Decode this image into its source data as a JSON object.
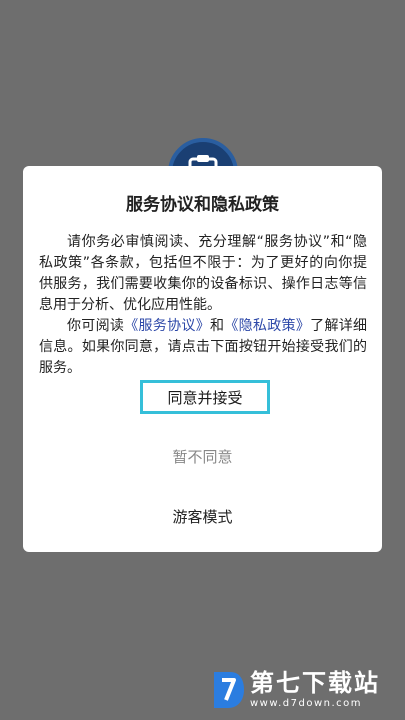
{
  "dialog": {
    "title": "服务协议和隐私政策",
    "para1": "请你务必审慎阅读、充分理解“服务协议”和“隐私政策”各条款，包括但不限于：为了更好的向你提供服务，我们需要收集你的设备标识、操作日志等信息用于分析、优化应用性能。",
    "para2_before": "你可阅读",
    "link_terms": "《服务协议》",
    "para2_and": "和",
    "link_privacy": "《隐私政策》",
    "para2_after": "了解详细信息。如果你同意，请点击下面按钮开始接受我们的服务。",
    "agree_label": "同意并接受",
    "disagree_label": "暂不同意",
    "guest_label": "游客模式"
  },
  "watermark": {
    "name": "第七下载站",
    "url": "www.d7down.com"
  },
  "colors": {
    "overlay": "#6e6e6e",
    "link": "#2d48a8",
    "button_border": "#35bfd9",
    "app_icon": "#1a3f73"
  },
  "icons": {
    "app": "clipboard-icon",
    "watermark_logo": "d7-logo-icon"
  }
}
